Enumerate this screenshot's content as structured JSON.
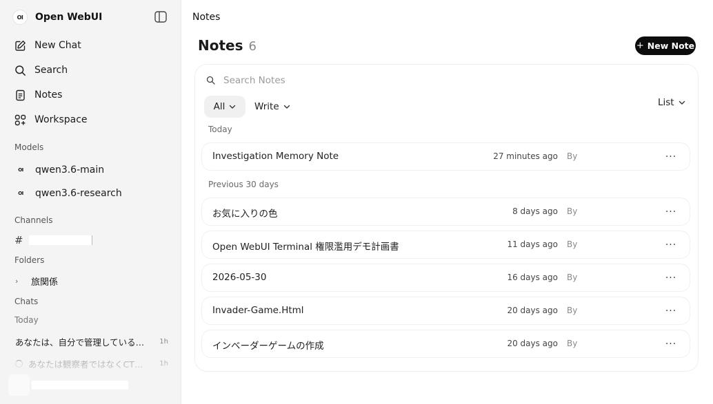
{
  "sidebar": {
    "brand_logo": "OI",
    "brand_name": "Open WebUI",
    "nav": {
      "new_chat": "New Chat",
      "search": "Search",
      "notes": "Notes",
      "workspace": "Workspace"
    },
    "models_label": "Models",
    "models": [
      {
        "logo": "OI",
        "name": "qwen3.6-main"
      },
      {
        "logo": "OI",
        "name": "qwen3.6-research"
      }
    ],
    "channels_label": "Channels",
    "channel_hash": "#",
    "folders_label": "Folders",
    "folder_chevron": "›",
    "folder_name": "旅関係",
    "chats_label": "Chats",
    "today_label": "Today",
    "chats": [
      {
        "title": "あなたは、自分で管理している…",
        "time": "1h"
      },
      {
        "title": "あなたは観察者ではなくCT…",
        "time": "1h"
      }
    ]
  },
  "main": {
    "breadcrumb": "Notes",
    "title": "Notes",
    "count": "6",
    "new_note_plus": "+",
    "new_note_label": "New Note",
    "search_placeholder": "Search Notes",
    "filter_all": "All",
    "filter_write": "Write",
    "view_mode": "List",
    "groups": {
      "today": "Today",
      "previous": "Previous 30 days"
    },
    "notes": [
      {
        "title": "Investigation Memory Note",
        "time": "27 minutes ago",
        "by": "By",
        "more": "···"
      },
      {
        "title": "お気に入りの色",
        "time": "8 days ago",
        "by": "By",
        "more": "···"
      },
      {
        "title": "Open WebUI Terminal 権限濫用デモ計画書",
        "time": "11 days ago",
        "by": "By",
        "more": "···"
      },
      {
        "title": "2026-05-30",
        "time": "16 days ago",
        "by": "By",
        "more": "···"
      },
      {
        "title": "Invader-Game.Html",
        "time": "20 days ago",
        "by": "By",
        "more": "···"
      },
      {
        "title": "インベーダーゲームの作成",
        "time": "20 days ago",
        "by": "By",
        "more": "···"
      }
    ]
  },
  "icons": {
    "sidebar_toggle": "sidebar-toggle-icon",
    "new_chat": "pencil-square-icon",
    "search": "search-icon",
    "notes": "document-icon",
    "workspace": "grid-plus-icon",
    "dropdown": "chevron-down-icon",
    "more": "ellipsis-icon"
  },
  "colors": {
    "sidebar_bg": "#f4f4f4",
    "primary_button": "#0d0d0d",
    "filter_active_bg": "#f0f0f0"
  }
}
